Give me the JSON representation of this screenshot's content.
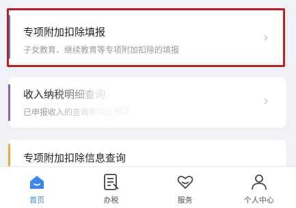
{
  "cards": [
    {
      "title": "专项附加扣除填报",
      "desc": "子女教育、继续教育等专项附加扣除的填报",
      "accent": "#3b86f5"
    },
    {
      "title": "收入纳税明细查询",
      "desc": "已申报收入的查询和异议申诉",
      "accent": "#8a5fd0"
    },
    {
      "title": "专项附加扣除信息查询",
      "accent": "#f2a93b"
    }
  ],
  "highlight_color": "#c8191e",
  "tabs": [
    {
      "label": "首页",
      "icon": "home-icon",
      "active": true
    },
    {
      "label": "办税",
      "icon": "tax-document-icon"
    },
    {
      "label": "服务",
      "icon": "heart-hands-icon"
    },
    {
      "label": "个人中心",
      "icon": "person-icon"
    }
  ],
  "colors": {
    "active_tab": "#3b86f5"
  }
}
